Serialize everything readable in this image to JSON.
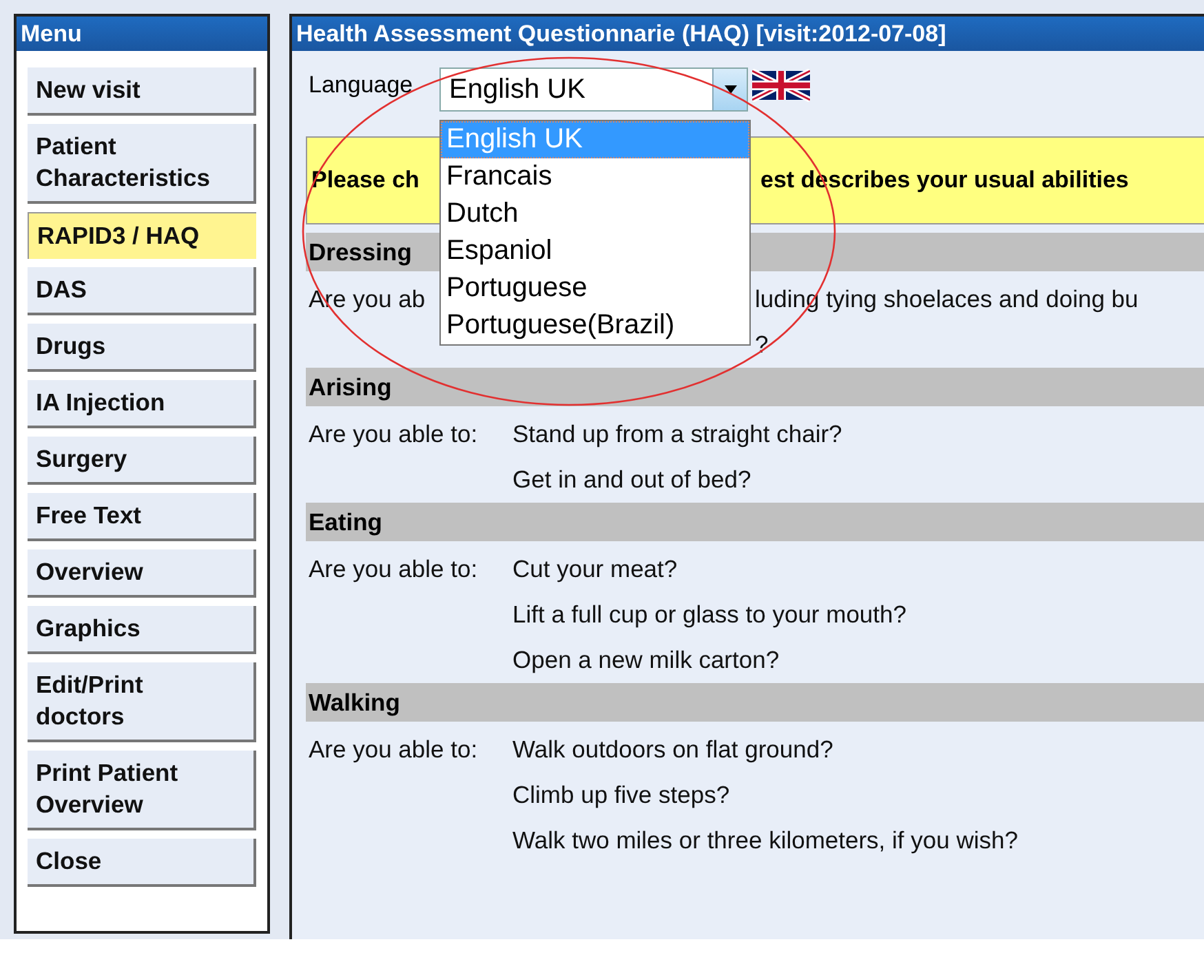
{
  "menu": {
    "title": "Menu",
    "items": [
      {
        "label": "New visit",
        "selected": false
      },
      {
        "label": "Patient Characteristics",
        "selected": false
      },
      {
        "label": "RAPID3 / HAQ",
        "selected": true
      },
      {
        "label": "DAS",
        "selected": false
      },
      {
        "label": "Drugs",
        "selected": false
      },
      {
        "label": "IA Injection",
        "selected": false
      },
      {
        "label": "Surgery",
        "selected": false
      },
      {
        "label": "Free Text",
        "selected": false
      },
      {
        "label": "Overview",
        "selected": false
      },
      {
        "label": "Graphics",
        "selected": false
      },
      {
        "label": "Edit/Print doctors",
        "selected": false
      },
      {
        "label": "Print Patient Overview",
        "selected": false
      },
      {
        "label": "Close",
        "selected": false
      }
    ]
  },
  "panel": {
    "title": "Health Assessment Questionnarie (HAQ) [visit:2012-07-08]",
    "language": {
      "label": "Language",
      "value": "English UK",
      "options": [
        {
          "label": "English UK",
          "selected": true
        },
        {
          "label": "Francais",
          "selected": false
        },
        {
          "label": "Dutch",
          "selected": false
        },
        {
          "label": "Espaniol",
          "selected": false
        },
        {
          "label": "Portuguese",
          "selected": false
        },
        {
          "label": "Portuguese(Brazil)",
          "selected": false
        }
      ]
    },
    "instruction": {
      "left": "Please ch",
      "right": "est describes your usual abilities"
    },
    "sections": [
      {
        "title": "Dressing",
        "rows": [
          {
            "kind": "covered",
            "left": "Are you ab",
            "right": "luding tying shoelaces and doing bu"
          },
          {
            "kind": "covered",
            "right": "?"
          }
        ]
      },
      {
        "title": "Arising",
        "rows": [
          {
            "kind": "question",
            "prompt": "Are you able to:",
            "question": "Stand up from a straight chair?"
          },
          {
            "kind": "question",
            "question": "Get in and out of bed?"
          }
        ]
      },
      {
        "title": "Eating",
        "rows": [
          {
            "kind": "question",
            "prompt": "Are you able to:",
            "question": "Cut your meat?"
          },
          {
            "kind": "question",
            "question": "Lift a full cup or glass to your mouth?"
          },
          {
            "kind": "question",
            "question": "Open a new milk carton?"
          }
        ]
      },
      {
        "title": "Walking",
        "rows": [
          {
            "kind": "question",
            "prompt": "Are you able to:",
            "question": "Walk outdoors on flat ground?"
          },
          {
            "kind": "question",
            "question": "Climb up five steps?"
          },
          {
            "kind": "question",
            "question": "Walk two miles or three kilometers, if you wish?"
          }
        ]
      }
    ]
  }
}
